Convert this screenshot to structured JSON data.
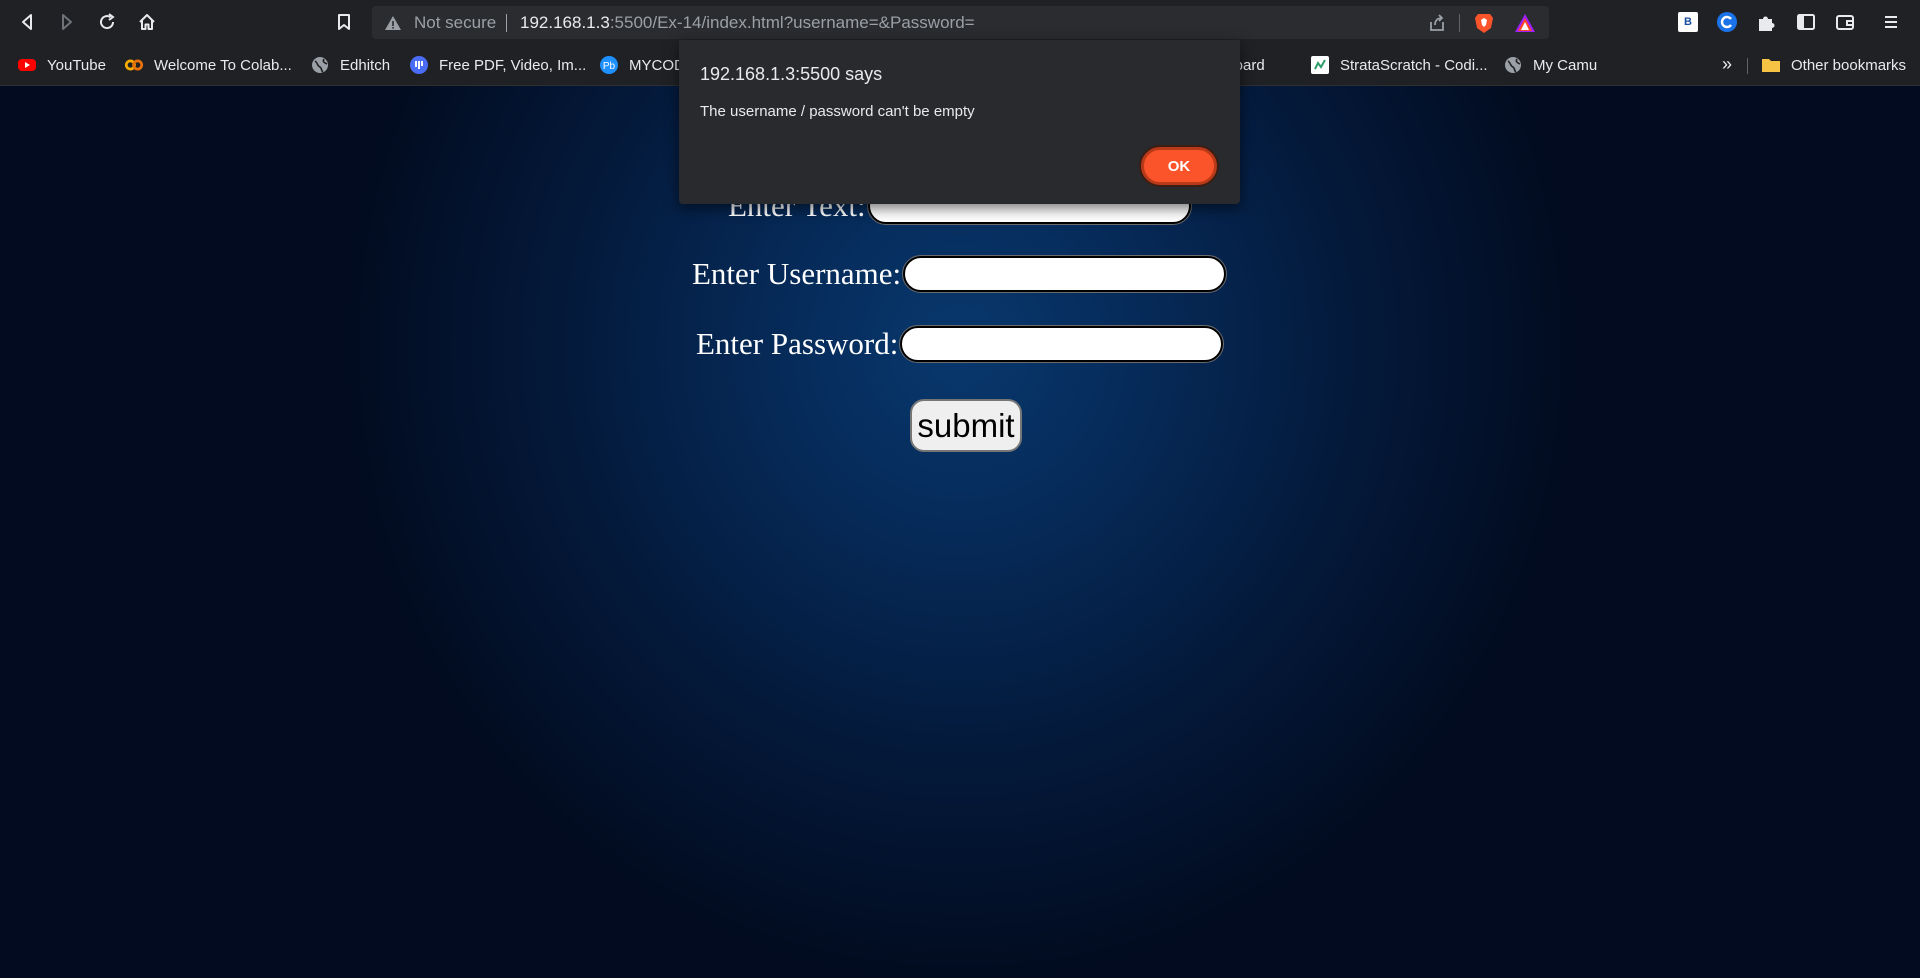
{
  "browser": {
    "omnibox": {
      "security_label": "Not secure",
      "url_host": "192.168.1.3",
      "url_path": ":5500/Ex-14/index.html?username=&Password="
    },
    "extensions": [
      "B"
    ]
  },
  "bookmarks": {
    "items": [
      {
        "label": "YouTube",
        "icon": "youtube-icon"
      },
      {
        "label": "Welcome To Colab...",
        "icon": "colab-icon"
      },
      {
        "label": "Edhitch",
        "icon": "globe-icon"
      },
      {
        "label": "Free PDF, Video, Im...",
        "icon": "tool-icon"
      },
      {
        "label": "MYCOD",
        "icon": "pb-icon"
      },
      {
        "label": "hboard",
        "icon": ""
      },
      {
        "label": "StrataScratch - Codi...",
        "icon": "stratascratch-icon"
      },
      {
        "label": "My Camu",
        "icon": "globe-icon"
      }
    ],
    "other_label": "Other bookmarks",
    "overflow_label": "»"
  },
  "form": {
    "text_label": "Enter Text:",
    "username_label": "Enter Username:",
    "password_label": "Enter Password:",
    "submit_label": "submit"
  },
  "dialog": {
    "title": "192.168.1.3:5500 says",
    "message": "The username / password can't be empty",
    "ok_label": "OK"
  },
  "colors": {
    "accent_ok": "#fb542b",
    "page_bg_center": "#08386e",
    "page_bg_edge": "#020b1f"
  }
}
